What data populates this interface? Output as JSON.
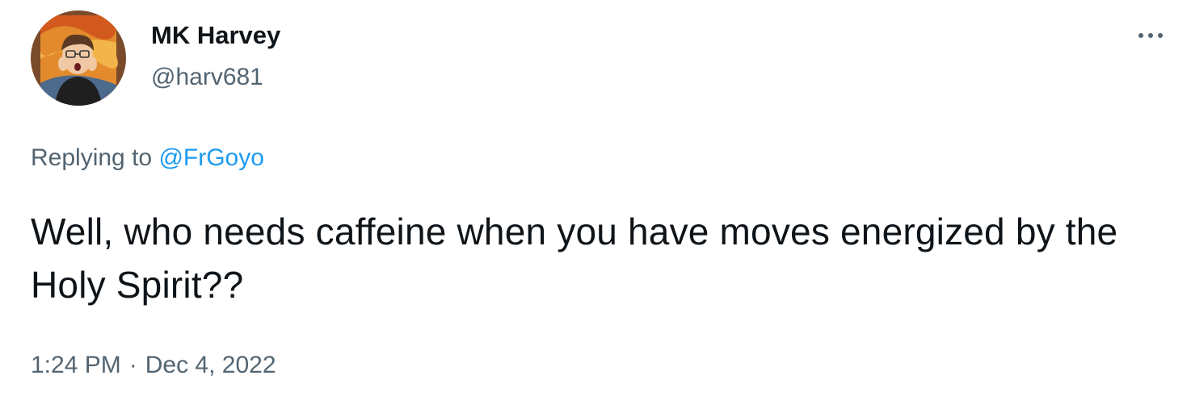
{
  "user": {
    "display_name": "MK Harvey",
    "handle": "@harv681",
    "avatar_icon": "bitmoji-avatar-icon"
  },
  "more_icon": "more-horizontal-icon",
  "reply": {
    "prefix": "Replying to",
    "mention": "@FrGoyo"
  },
  "tweet": {
    "text": "Well, who needs caffeine when you have moves energized by the Holy Spirit??"
  },
  "meta": {
    "time": "1:24 PM",
    "separator": "·",
    "date": "Dec 4, 2022"
  },
  "colors": {
    "text_primary": "#0f1419",
    "text_secondary": "#536471",
    "accent": "#1d9bf0"
  }
}
